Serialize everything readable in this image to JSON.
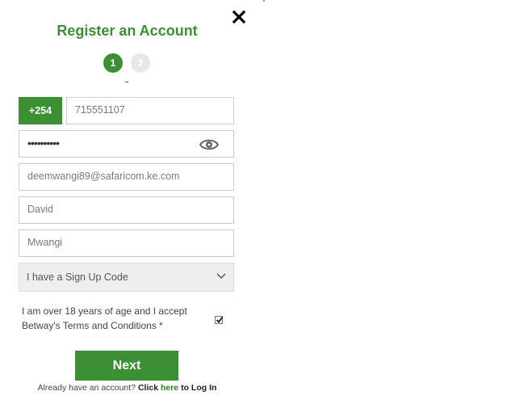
{
  "header": {
    "title": "Register an Account"
  },
  "steps": [
    {
      "label": "1"
    },
    {
      "label": "2"
    }
  ],
  "form": {
    "country_code": "+254",
    "phone_value": "715551107",
    "password_mask": "••••••••••",
    "email_value": "deemwangi89@safaricom.ke.com",
    "first_name_value": "David",
    "last_name_value": "Mwangi",
    "signup_code_select": "I have a Sign Up Code"
  },
  "terms": {
    "text": "I am over 18 years of age and I accept Betway's Terms and Conditions *",
    "checked": true
  },
  "actions": {
    "next_label": "Next"
  },
  "login": {
    "prefix": "Already have an account?",
    "click": "Click",
    "here": "here",
    "suffix": "to Log In"
  },
  "colors": {
    "accent": "#3c8f33",
    "step_inactive": "#e7e7e7",
    "select_bg": "#eeeeee"
  },
  "icons": {
    "close": "close-icon",
    "eye": "eye-icon",
    "chevron": "chevron-down-icon",
    "check": "check-icon"
  }
}
